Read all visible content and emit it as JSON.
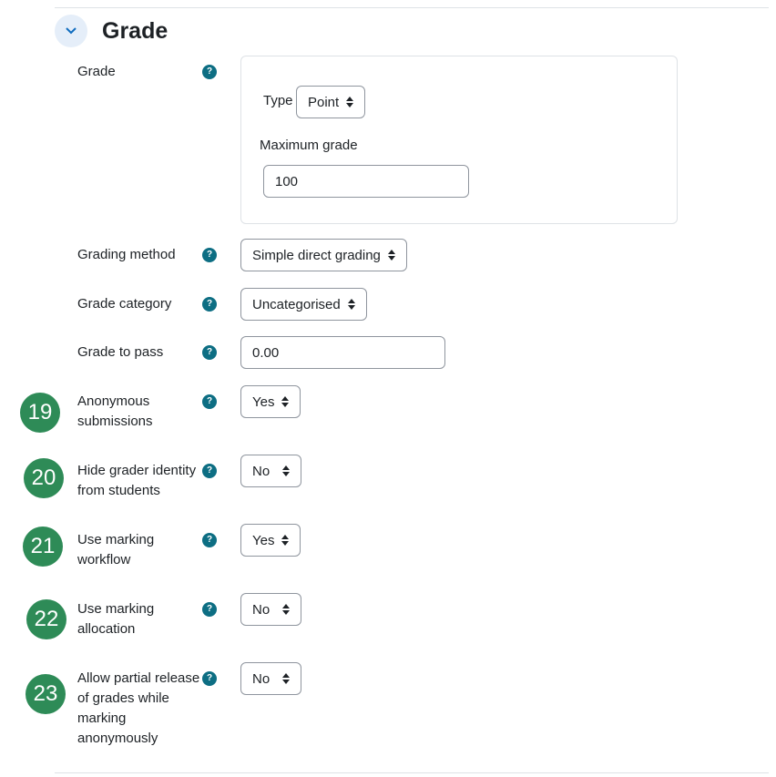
{
  "section": {
    "title": "Grade",
    "collapse_icon": "chevron-down-icon",
    "accent": "#0f6cbf"
  },
  "grade": {
    "label": "Grade",
    "type_label": "Type",
    "type_value": "Point",
    "max_label": "Maximum grade",
    "max_value": "100"
  },
  "fields": {
    "grading_method": {
      "label": "Grading method",
      "value": "Simple direct grading"
    },
    "grade_category": {
      "label": "Grade category",
      "value": "Uncategorised"
    },
    "grade_to_pass": {
      "label": "Grade to pass",
      "value": "0.00"
    },
    "anonymous": {
      "label": "Anonymous submissions",
      "value": "Yes",
      "badge": "19"
    },
    "hide_grader": {
      "label": "Hide grader identity from students",
      "value": "No",
      "badge": "20"
    },
    "marking_workflow": {
      "label": "Use marking workflow",
      "value": "Yes",
      "badge": "21"
    },
    "marking_allocation": {
      "label": "Use marking allocation",
      "value": "No",
      "badge": "22"
    },
    "partial_release": {
      "label": "Allow partial release of grades while marking anonymously",
      "value": "No",
      "badge": "23"
    }
  },
  "help_glyph": "?",
  "colors": {
    "help": "#0d6e83",
    "badge": "#2e8b57",
    "border": "#8f959e"
  }
}
